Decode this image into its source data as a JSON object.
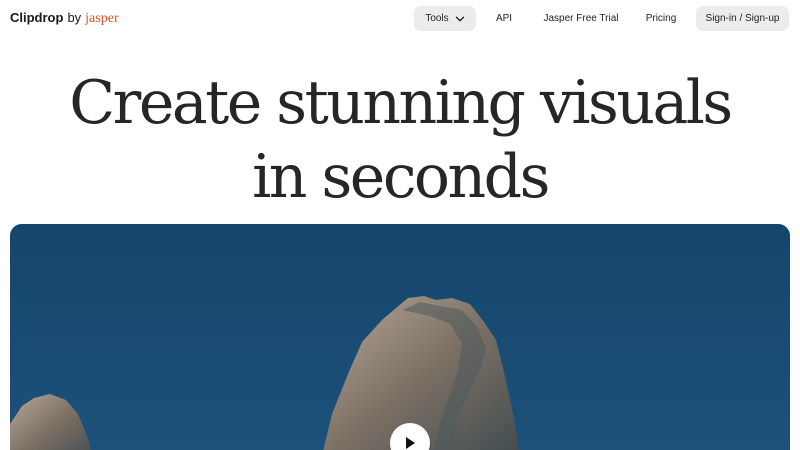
{
  "brand": {
    "name": "Clipdrop",
    "by": "by",
    "partner": "jasper",
    "partner_color": "#e0502f"
  },
  "nav": {
    "tools_label": "Tools",
    "api_label": "API",
    "trial_label": "Jasper Free Trial",
    "pricing_label": "Pricing",
    "signin_label": "Sign-in / Sign-up"
  },
  "hero": {
    "line1": "Create stunning visuals",
    "line2": "in seconds"
  },
  "media": {
    "background_color": "#1a4a72",
    "play_icon": "play-icon"
  }
}
